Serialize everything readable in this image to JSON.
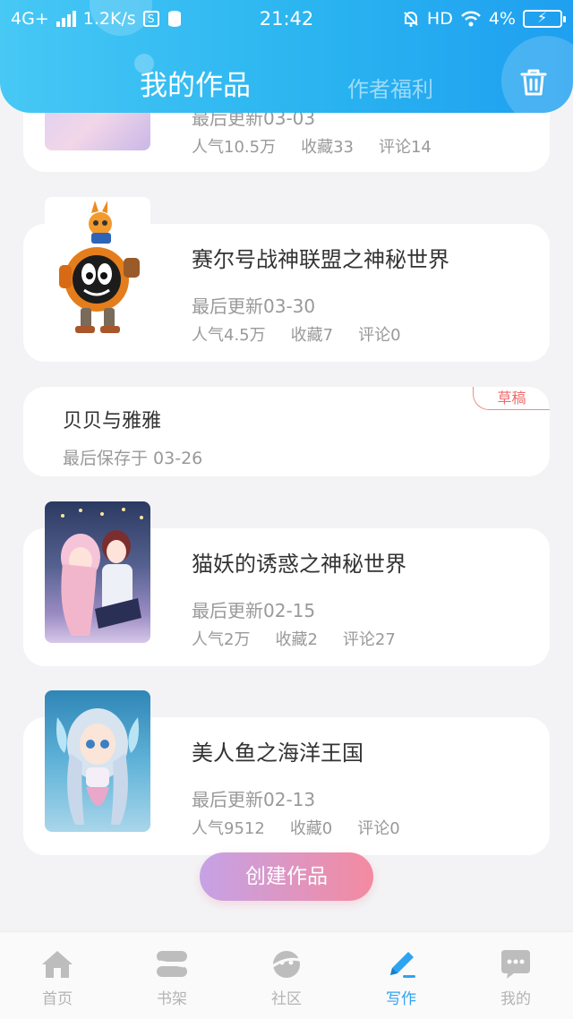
{
  "status_bar": {
    "network": "4G+",
    "speed": "1.2K/s",
    "time": "21:42",
    "hd": "HD",
    "battery": "4%"
  },
  "header": {
    "title": "我的作品",
    "tab_welfare": "作者福利"
  },
  "works": [
    {
      "date": "最后更新03-03",
      "popularity": "人气10.5万",
      "favorites": "收藏33",
      "comments": "评论14"
    },
    {
      "title": "赛尔号战神联盟之神秘世界",
      "date": "最后更新03-30",
      "popularity": "人气4.5万",
      "favorites": "收藏7",
      "comments": "评论0"
    },
    {
      "title": "猫妖的诱惑之神秘世界",
      "date": "最后更新02-15",
      "popularity": "人气2万",
      "favorites": "收藏2",
      "comments": "评论27"
    },
    {
      "title": "美人鱼之海洋王国",
      "date": "最后更新02-13",
      "popularity": "人气9512",
      "favorites": "收藏0",
      "comments": "评论0"
    }
  ],
  "draft": {
    "title": "贝贝与雅雅",
    "date": "最后保存于 03-26",
    "badge": "草稿"
  },
  "create_button": "创建作品",
  "bottom_nav": [
    {
      "label": "首页",
      "icon": "home-icon"
    },
    {
      "label": "书架",
      "icon": "bookshelf-icon"
    },
    {
      "label": "社区",
      "icon": "community-icon"
    },
    {
      "label": "写作",
      "icon": "write-icon"
    },
    {
      "label": "我的",
      "icon": "profile-icon"
    }
  ],
  "colors": {
    "header": "#2ab4f0",
    "accent": "#2ea3f2",
    "draft": "#ef6b6b",
    "create_start": "#c5a2e6",
    "create_end": "#f48aa0"
  }
}
